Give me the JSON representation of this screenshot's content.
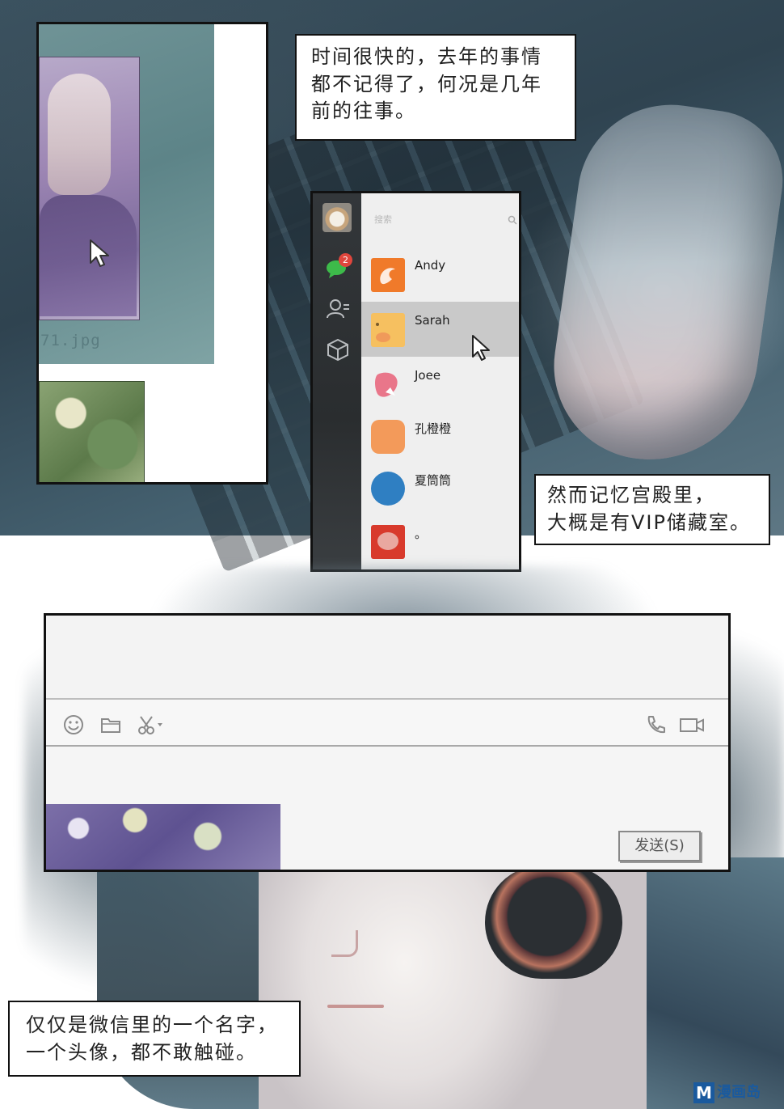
{
  "captions": {
    "top": [
      "时间很快的，去年的事情",
      "都不记得了，何况是几年",
      "前的往事。"
    ],
    "middle": [
      "然而记忆宫殿里，",
      "大概是有VIP储藏室。"
    ],
    "bottom": [
      "仅仅是微信里的一个名字，",
      "一个头像，都不敢触碰。"
    ]
  },
  "viewer": {
    "filename": "71.jpg"
  },
  "wechat": {
    "search_placeholder": "搜索",
    "unread_badge": "2",
    "contacts": [
      {
        "name": "Andy",
        "avatar_color": "#f07a2a",
        "selected": false
      },
      {
        "name": "Sarah",
        "avatar_color": "#f6c060",
        "selected": true
      },
      {
        "name": "Joee",
        "avatar_color": "#e9768a",
        "selected": false
      },
      {
        "name": "孔橙橙",
        "avatar_color": "#f39a5a",
        "selected": false
      },
      {
        "name": "夏筒筒",
        "avatar_color": "#2f7fc2",
        "selected": false
      },
      {
        "name": "。",
        "avatar_color": "#d83a2c",
        "selected": false
      }
    ],
    "icons": [
      "chat-icon",
      "contacts-icon",
      "favorites-icon"
    ]
  },
  "chat_window": {
    "send_label": "发送(S)",
    "toolbar_icons": [
      "emoji-icon",
      "folder-icon",
      "scissors-icon",
      "phone-icon",
      "video-icon"
    ]
  },
  "watermark": {
    "logo_letter": "M",
    "text": "漫画岛"
  },
  "colors": {
    "badge": "#e0463d",
    "selected_row": "#c9c9c9",
    "watermark": "#1a5a9e"
  }
}
